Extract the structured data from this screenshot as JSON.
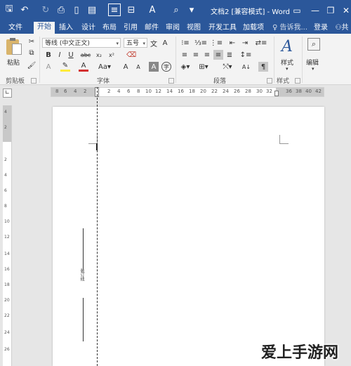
{
  "titlebar": {
    "title": "文档2 [兼容模式] - Word",
    "icons": [
      "save-icon",
      "undo-icon",
      "redo-icon",
      "print-preview-icon",
      "new-doc-icon",
      "paste-special-icon",
      "page-view-icon",
      "align-icon",
      "font-color-icon",
      "find-icon"
    ]
  },
  "tabs": [
    "文件",
    "开始",
    "插入",
    "设计",
    "布局",
    "引用",
    "邮件",
    "审阅",
    "视图",
    "开发工具",
    "加载项"
  ],
  "active_tab": "开始",
  "tellme": "告诉我...",
  "login": "登录",
  "share": "共",
  "ribbon": {
    "paste_label": "粘贴",
    "font_name": "等线 (中文正文)",
    "font_size": "五号",
    "font_size_glyph": "x₁",
    "size_grow": "A",
    "size_shrink": "A",
    "bold": "B",
    "italic": "I",
    "underline": "U",
    "strike": "abc",
    "sub": "x₂",
    "sup": "x²",
    "wen": "wén",
    "style_label": "样式",
    "edit_label": "编辑",
    "groups": {
      "clipboard": "剪贴板",
      "font": "字体",
      "paragraph": "段落",
      "styles": "样式"
    }
  },
  "ruler": {
    "h_left": [
      "8",
      "6",
      "4",
      "2"
    ],
    "h_right": [
      "2",
      "4",
      "6",
      "8",
      "10",
      "12",
      "14",
      "16",
      "18",
      "20",
      "22",
      "24",
      "26",
      "28",
      "30",
      "32",
      "36",
      "38",
      "40",
      "42"
    ],
    "v_nums": [
      "4",
      "2",
      "2",
      "4",
      "6",
      "8",
      "10",
      "12",
      "14",
      "16",
      "18",
      "20",
      "22",
      "24",
      "26"
    ]
  },
  "document": {
    "vertical_text": "装订线"
  },
  "watermark": "爱上手游网"
}
